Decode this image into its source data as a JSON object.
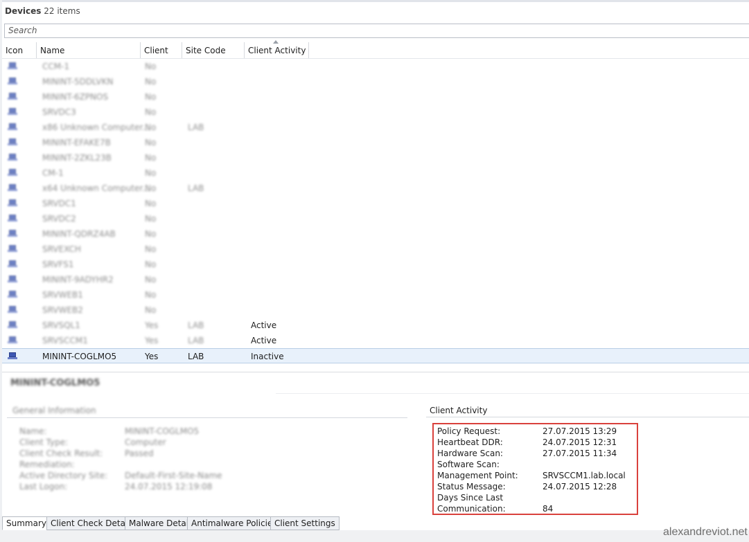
{
  "header": {
    "title": "Devices",
    "count": "22 items"
  },
  "search": {
    "placeholder": "Search"
  },
  "columns": {
    "icon": "Icon",
    "name": "Name",
    "client": "Client",
    "site": "Site Code",
    "activity": "Client Activity"
  },
  "rows": [
    {
      "name": "CCM-1",
      "client": "No",
      "site": "",
      "activity": ""
    },
    {
      "name": "MININT-5DDLVKN",
      "client": "No",
      "site": "",
      "activity": ""
    },
    {
      "name": "MININT-6ZPNOS",
      "client": "No",
      "site": "",
      "activity": ""
    },
    {
      "name": "SRVDC3",
      "client": "No",
      "site": "",
      "activity": ""
    },
    {
      "name": "x86 Unknown Computer...",
      "client": "No",
      "site": "LAB",
      "activity": ""
    },
    {
      "name": "MININT-EFAKE7B",
      "client": "No",
      "site": "",
      "activity": ""
    },
    {
      "name": "MININT-2ZKL23B",
      "client": "No",
      "site": "",
      "activity": ""
    },
    {
      "name": "CM-1",
      "client": "No",
      "site": "",
      "activity": ""
    },
    {
      "name": "x64 Unknown Computer...",
      "client": "No",
      "site": "LAB",
      "activity": ""
    },
    {
      "name": "SRVDC1",
      "client": "No",
      "site": "",
      "activity": ""
    },
    {
      "name": "SRVDC2",
      "client": "No",
      "site": "",
      "activity": ""
    },
    {
      "name": "MININT-QDRZ4AB",
      "client": "No",
      "site": "",
      "activity": ""
    },
    {
      "name": "SRVEXCH",
      "client": "No",
      "site": "",
      "activity": ""
    },
    {
      "name": "SRVFS1",
      "client": "No",
      "site": "",
      "activity": ""
    },
    {
      "name": "MININT-9ADYHR2",
      "client": "No",
      "site": "",
      "activity": ""
    },
    {
      "name": "SRVWEB1",
      "client": "No",
      "site": "",
      "activity": ""
    },
    {
      "name": "SRVWEB2",
      "client": "No",
      "site": "",
      "activity": ""
    },
    {
      "name": "SRVSQL1",
      "client": "Yes",
      "site": "LAB",
      "activity": "Active"
    },
    {
      "name": "SRVSCCM1",
      "client": "Yes",
      "site": "LAB",
      "activity": "Active"
    },
    {
      "name": "MININT-COGLMO5",
      "client": "Yes",
      "site": "LAB",
      "activity": "Inactive"
    }
  ],
  "detail": {
    "title": "MININT-COGLMO5",
    "general_title": "General Information",
    "general": [
      {
        "label": "Name:",
        "value": "MININT-COGLMO5"
      },
      {
        "label": "Client Type:",
        "value": "Computer"
      },
      {
        "label": "Client Check Result:",
        "value": "Passed"
      },
      {
        "label": "Remediation:",
        "value": ""
      },
      {
        "label": "Active Directory Site:",
        "value": "Default-First-Site-Name"
      },
      {
        "label": "Last Logon:",
        "value": "24.07.2015 12:19:08"
      }
    ],
    "activity_title": "Client Activity",
    "activity": [
      {
        "label": "Policy Request:",
        "value": "27.07.2015 13:29"
      },
      {
        "label": "Heartbeat DDR:",
        "value": "24.07.2015 12:31"
      },
      {
        "label": "Hardware Scan:",
        "value": "27.07.2015 11:34"
      },
      {
        "label": "Software Scan:",
        "value": ""
      },
      {
        "label": "Management Point:",
        "value": "SRVSCCM1.lab.local"
      },
      {
        "label": "Status Message:",
        "value": "24.07.2015 12:28"
      },
      {
        "label": "Days Since Last",
        "value": ""
      },
      {
        "label": "Communication:",
        "value": "84"
      }
    ]
  },
  "tabs": [
    "Summary",
    "Client Check Detail",
    "Malware Detail",
    "Antimalware Policies",
    "Client Settings"
  ],
  "watermark": "alexandreviot.net",
  "colors": {
    "highlight_border": "#d9413c",
    "selected_row": "#e8f1fb",
    "device_icon": "#3d57b3"
  }
}
